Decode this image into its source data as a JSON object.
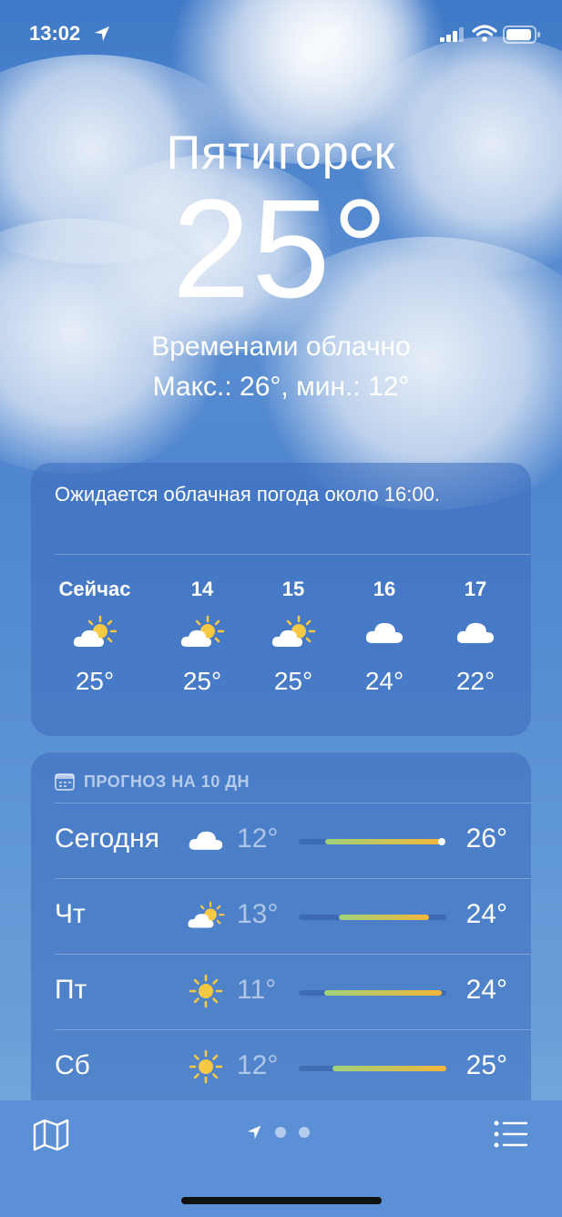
{
  "status_bar": {
    "time": "13:02"
  },
  "header": {
    "city": "Пятигорск",
    "temperature": "25°",
    "condition": "Временами облачно",
    "high_low": "Макс.: 26°, мин.: 12°"
  },
  "hourly": {
    "summary": "Ожидается облачная погода около 16:00.",
    "items": [
      {
        "label": "Сейчас",
        "icon": "partly-cloudy-icon",
        "temp": "25°"
      },
      {
        "label": "14",
        "icon": "partly-cloudy-icon",
        "temp": "25°"
      },
      {
        "label": "15",
        "icon": "partly-cloudy-icon",
        "temp": "25°"
      },
      {
        "label": "16",
        "icon": "cloud-icon",
        "temp": "24°"
      },
      {
        "label": "17",
        "icon": "cloud-icon",
        "temp": "22°"
      }
    ]
  },
  "daily": {
    "title": "ПРОГНОЗ НА 10 ДН",
    "rows": [
      {
        "day": "Сегодня",
        "icon": "cloud-icon",
        "low": "12°",
        "high": "26°",
        "range_start": 0.18,
        "range_end": 0.97,
        "current": 0.97
      },
      {
        "day": "Чт",
        "icon": "partly-cloudy-icon",
        "low": "13°",
        "high": "24°",
        "range_start": 0.27,
        "range_end": 0.88
      },
      {
        "day": "Пт",
        "icon": "sun-icon",
        "low": "11°",
        "high": "24°",
        "range_start": 0.17,
        "range_end": 0.97
      },
      {
        "day": "Сб",
        "icon": "sun-icon",
        "low": "12°",
        "high": "25°",
        "range_start": 0.23,
        "range_end": 1.0
      }
    ]
  },
  "colors": {
    "sun": "#f6c944",
    "bar_cool": "#9fd27a",
    "bar_warm": "#f3b63a"
  }
}
